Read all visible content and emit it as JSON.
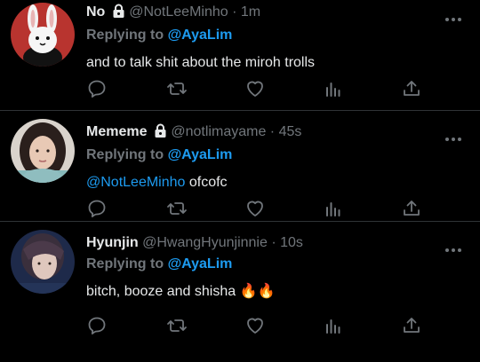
{
  "tweets": [
    {
      "name": "No",
      "handle": "@NotLeeMinho",
      "dot": "·",
      "time": "1m",
      "replying_label": "Replying to",
      "replying_to": "@AyaLim",
      "text": "and to talk shit about the miroh trolls",
      "mention": "",
      "locked": true,
      "avatar_icon": "bunny-avatar"
    },
    {
      "name": "Mememe",
      "handle": "@notlimayame",
      "dot": "·",
      "time": "45s",
      "replying_label": "Replying to",
      "replying_to": "@AyaLim",
      "mention": "@NotLeeMinho",
      "text": " ofcofc",
      "locked": true,
      "avatar_icon": "woman-photo-avatar"
    },
    {
      "name": "Hyunjin",
      "handle": "@HwangHyunjinnie",
      "dot": "·",
      "time": "10s",
      "replying_label": "Replying to",
      "replying_to": "@AyaLim",
      "mention": "",
      "text": "bitch, booze and shisha 🔥🔥",
      "locked": false,
      "avatar_icon": "man-photo-avatar"
    }
  ],
  "icons": {
    "reply": "reply-icon",
    "retweet": "retweet-icon",
    "like": "like-icon",
    "views": "analytics-icon",
    "share": "share-icon",
    "more": "more-icon",
    "lock": "lock-icon"
  },
  "colors": {
    "background": "#000000",
    "text": "#e7e9ea",
    "muted": "#71767b",
    "link": "#1d9bf0",
    "border": "#2f3336"
  }
}
